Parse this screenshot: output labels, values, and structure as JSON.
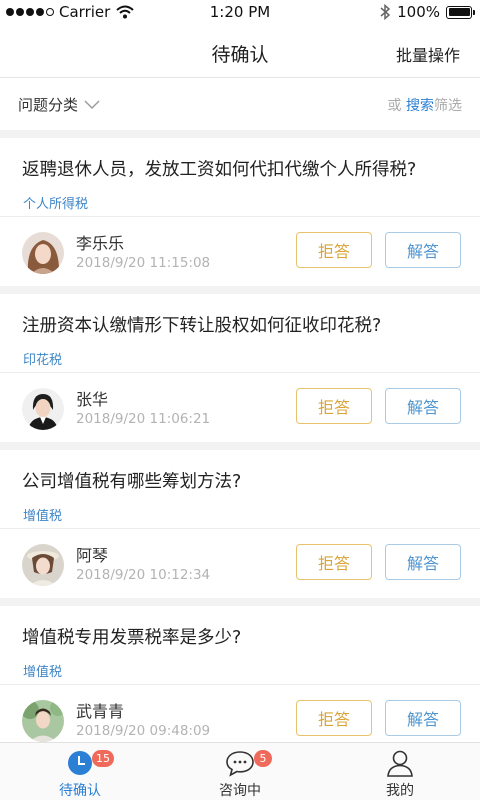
{
  "status_bar": {
    "carrier": "Carrier",
    "time": "1:20 PM",
    "battery": "100%"
  },
  "nav": {
    "title": "待确认",
    "action": "批量操作"
  },
  "filter": {
    "category_label": "问题分类",
    "prefix": "或",
    "search_label": "搜索",
    "suffix": "筛选"
  },
  "questions": [
    {
      "title": "返聘退休人员，发放工资如何代扣代缴个人所得税?",
      "tag": "个人所得税",
      "user": "李乐乐",
      "time": "2018/9/20 11:15:08",
      "reject": "拒答",
      "answer": "解答"
    },
    {
      "title": "注册资本认缴情形下转让股权如何征收印花税?",
      "tag": "印花税",
      "user": "张华",
      "time": "2018/9/20 11:06:21",
      "reject": "拒答",
      "answer": "解答"
    },
    {
      "title": "公司增值税有哪些筹划方法?",
      "tag": "增值税",
      "user": "阿琴",
      "time": "2018/9/20 10:12:34",
      "reject": "拒答",
      "answer": "解答"
    },
    {
      "title": "增值税专用发票税率是多少?",
      "tag": "增值税",
      "user": "武青青",
      "time": "2018/9/20 09:48:09",
      "reject": "拒答",
      "answer": "解答"
    }
  ],
  "tabs": [
    {
      "label": "待确认",
      "badge": "15",
      "icon": "clock-icon"
    },
    {
      "label": "咨询中",
      "badge": "5",
      "icon": "chat-bubble-icon"
    },
    {
      "label": "我的",
      "icon": "user-icon"
    }
  ],
  "colors": {
    "accent": "#2b7fd4",
    "reject": "#d9a43a",
    "answer": "#4f94cf",
    "badge": "#ef6a5b",
    "tag": "#3f86c7"
  }
}
